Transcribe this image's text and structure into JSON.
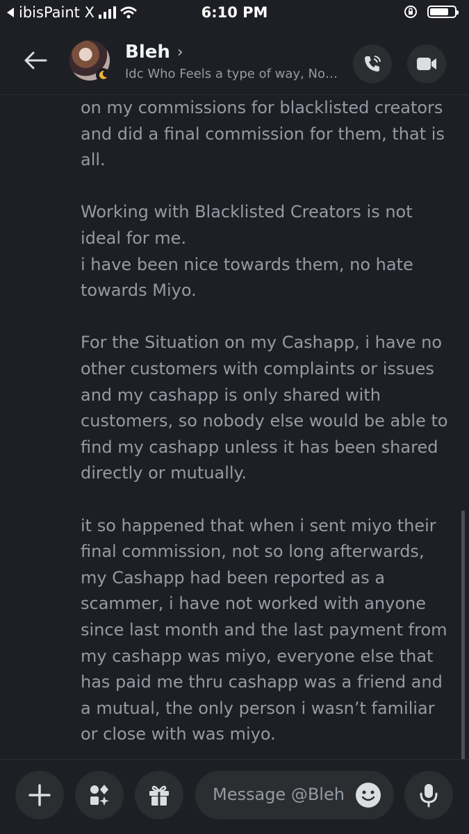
{
  "status_bar": {
    "back_app": "ibisPaint X",
    "time": "6:10 PM",
    "battery_level": 0.75,
    "signal_bars": 4,
    "icons": [
      "back-arrow-icon",
      "cellular-signal-icon",
      "wifi-icon",
      "orientation-lock-icon",
      "battery-icon"
    ]
  },
  "header": {
    "name": "Bleh",
    "chevron": "›",
    "status": "Idc Who Feels a type of way, No…",
    "icons": [
      "back-arrow-icon",
      "avatar",
      "moon-badge-icon",
      "phone-call-icon",
      "video-camera-icon"
    ]
  },
  "messages": {
    "paragraphs": [
      [
        "on my commissions for blacklisted creators",
        "and did a final commission for them, that is",
        "all."
      ],
      [
        "Working with Blacklisted Creators is not",
        "ideal for me.",
        "i have been nice towards them, no hate",
        "towards Miyo."
      ],
      [
        "For the Situation on my Cashapp, i have no",
        "other customers with complaints or issues",
        "and my cashapp is only shared with",
        "customers, so nobody else would be able to",
        "find my cashapp unless it has been shared",
        "directly or mutually."
      ],
      [
        "it so happened that when i sent miyo their",
        "final commission, not so long afterwards,",
        "my Cashapp had been reported as a",
        "scammer, i have not worked with anyone",
        "since last month and the last payment from",
        "my cashapp was miyo, everyone else that",
        "has paid me thru cashapp was a friend and",
        "a mutual, the only person i wasn’t familiar",
        "or close with was miyo."
      ]
    ]
  },
  "composer": {
    "placeholder": "Message @Bleh",
    "icons": [
      "plus-icon",
      "apps-icon",
      "gift-icon",
      "emoji-icon",
      "microphone-icon"
    ]
  },
  "colors": {
    "background": "#1e1f24",
    "button_bg": "#2b2d31",
    "muted_text": "#949ba4",
    "name_text": "#f2f3f5",
    "icon": "#dbdee1"
  }
}
